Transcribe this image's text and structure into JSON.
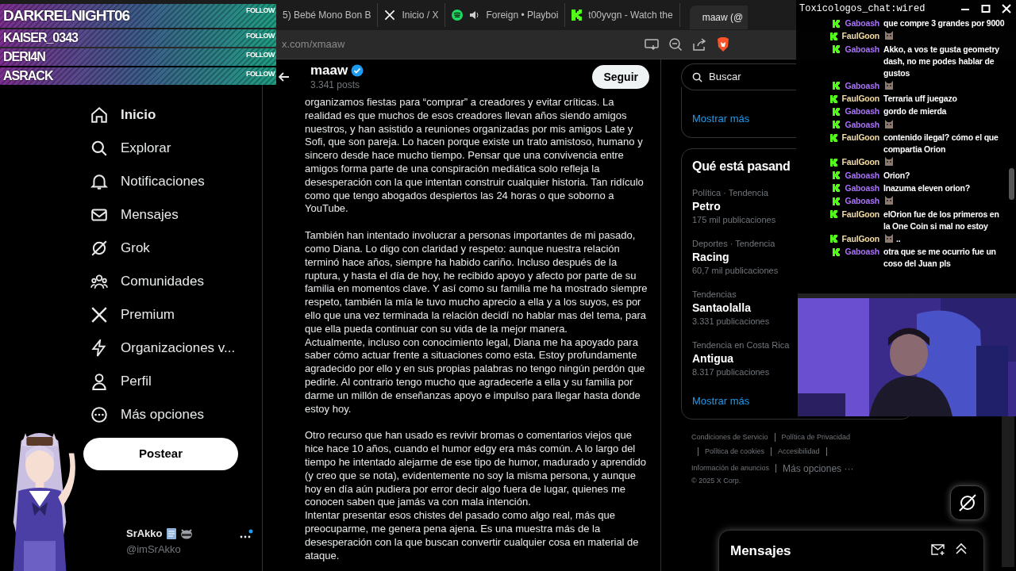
{
  "follower_alerts": [
    {
      "name": "DARKRELNIGHT06",
      "label": "FOLLOW"
    },
    {
      "name": "KAISER_0343",
      "label": "FOLLOW"
    },
    {
      "name": "DERI4N",
      "label": "FOLLOW"
    },
    {
      "name": "ASRACK",
      "label": "FOLLOW"
    }
  ],
  "browser": {
    "tabs": [
      {
        "title": "5) Bebé Mono Bon B",
        "selected": false
      },
      {
        "title": "Inicio / X",
        "selected": false
      },
      {
        "title": "Foreign • Playboi",
        "selected": false
      },
      {
        "title": "t00yvgn - Watch the",
        "selected": false
      },
      {
        "title": "maaw (@",
        "selected": true
      }
    ],
    "url": "x.com/xmaaw"
  },
  "nav": {
    "items": [
      {
        "label": "Inicio",
        "selected": true
      },
      {
        "label": "Explorar",
        "selected": false
      },
      {
        "label": "Notificaciones",
        "selected": false
      },
      {
        "label": "Mensajes",
        "selected": false
      },
      {
        "label": "Grok",
        "selected": false
      },
      {
        "label": "Comunidades",
        "selected": false
      },
      {
        "label": "Premium",
        "selected": false
      },
      {
        "label": "Organizaciones v...",
        "selected": false
      },
      {
        "label": "Perfil",
        "selected": false
      },
      {
        "label": "Más opciones",
        "selected": false
      }
    ],
    "post_button": "Postear",
    "account": {
      "name": "SrAkko",
      "handle": "@imSrAkko"
    }
  },
  "profile": {
    "name": "maaw",
    "posts": "3.341 posts",
    "follow_button": "Seguir"
  },
  "post": {
    "groups": [
      [
        "organizamos fiestas para “comprar” a creadores y evitar críticas. La realidad es que muchos de esos creadores llevan años siendo amigos nuestros, y han asistido a reuniones organizadas por mis amigos Late y Sofi, que son pareja. Lo hacen porque existe un trato amistoso, humano y sincero desde hace mucho tiempo. Pensar que una convivencia entre amigos forma parte de una conspiración mediática solo refleja la desesperación con la que intentan construir cualquier historia. Tan ridículo como que tengo abogados despiertos las 24 horas o que soborno a YouTube."
      ],
      [
        "También han intentado involucrar a personas importantes de mi pasado, como Diana. Lo digo con claridad y respeto: aunque nuestra relación terminó hace años, siempre ha habido cariño. Incluso después de la ruptura, y hasta el día de hoy, he recibido apoyo y afecto por parte de su familia en momentos clave. Y así como su familia me ha mostrado siempre respeto, también la mía le tuvo mucho aprecio a ella y a los suyos, es por ello que una vez terminada la relación decidí no hablar mas del tema, para que ella pueda continuar con su vida de la mejor manera.",
        "Actualmente, incluso con conocimiento legal, Diana me ha apoyado para saber cómo actuar frente a situaciones como esta. Estoy profundamente agradecido por ello y en sus propias palabras no tengo ningún perdón que pedirle. Al contrario tengo mucho que agradecerle a ella y su familia por darme un millón de enseñanzas apoyo e impulso para llegar hasta donde estoy hoy."
      ],
      [
        "Otro recurso que han usado es revivir bromas o comentarios viejos que hice hace 10 años, cuando el humor edgy era más común. A lo largo del tiempo he intentado alejarme de ese tipo de humor, madurado y aprendido (y creo que se nota), evidentemente no soy la misma persona, y aunque hoy en día aún pudiera por error decir algo fuera de lugar, quienes me conocen saben que jamás va con mala intención.",
        "Intentar presentar esos chistes del pasado como algo real, más que preocuparme, me genera pena ajena. Es una muestra más de la desesperación con la que buscan convertir cualquier cosa en material de ataque."
      ]
    ]
  },
  "sidebar": {
    "search": {
      "placeholder": "Buscar"
    },
    "show_more": "Mostrar más",
    "trends_title": "Qué está pasand",
    "trends": [
      {
        "category": "Política · Tendencia",
        "name": "Petro",
        "count": "175 mil publicaciones"
      },
      {
        "category": "Deportes · Tendencia",
        "name": "Racing",
        "count": "60,7 mil publicaciones"
      },
      {
        "category": "Tendencias",
        "name": "Santaolalla",
        "count": "3.331 publicaciones"
      },
      {
        "category": "Tendencia en Costa Rica",
        "name": "Antigua",
        "count": "8.317 publicaciones"
      }
    ],
    "trends_more": "Mostrar más",
    "footer_links": [
      "Condiciones de Servicio",
      "Política de Privacidad",
      "Política de cookies",
      "Accesibilidad",
      "Información de anuncios",
      "Más opciones ···"
    ],
    "copyright": "© 2025 X Corp.",
    "messages_drawer": "Mensajes"
  },
  "chat": {
    "title": "Toxicologos_chat:wired",
    "messages": [
      {
        "user": "Gaboash",
        "color": "#a970ff",
        "kind": "text",
        "text": "que compre 3 grandes por 9000"
      },
      {
        "user": "FaulGoon",
        "color": "#f2dca8",
        "kind": "emote"
      },
      {
        "user": "Gaboash",
        "color": "#a970ff",
        "kind": "text",
        "text": "Akko, a vos te gusta geometry dash, no me podes hablar de gustos"
      },
      {
        "user": "Gaboash",
        "color": "#a970ff",
        "kind": "emote"
      },
      {
        "user": "FaulGoon",
        "color": "#f2dca8",
        "kind": "text",
        "text": "Terraria uff juegazo"
      },
      {
        "user": "Gaboash",
        "color": "#a970ff",
        "kind": "text",
        "text": "gordo de mierda"
      },
      {
        "user": "Gaboash",
        "color": "#a970ff",
        "kind": "emote"
      },
      {
        "user": "FaulGoon",
        "color": "#f2dca8",
        "kind": "text",
        "text": "contenido ilegal? cómo el que compartia Orion"
      },
      {
        "user": "FaulGoon",
        "color": "#f2dca8",
        "kind": "emote"
      },
      {
        "user": "Gaboash",
        "color": "#a970ff",
        "kind": "text",
        "text": "Orion?"
      },
      {
        "user": "Gaboash",
        "color": "#a970ff",
        "kind": "text",
        "text": "Inazuma eleven orion?"
      },
      {
        "user": "Gaboash",
        "color": "#a970ff",
        "kind": "emote"
      },
      {
        "user": "FaulGoon",
        "color": "#f2dca8",
        "kind": "text",
        "text": "elOrion fue de los primeros en la One Coin si mal no estoy"
      },
      {
        "user": "FaulGoon",
        "color": "#f2dca8",
        "kind": "emote",
        "text": ".."
      },
      {
        "user": "Gaboash",
        "color": "#a970ff",
        "kind": "text",
        "text": "otra que se me ocurrio fue un coso del Juan pls"
      }
    ]
  }
}
